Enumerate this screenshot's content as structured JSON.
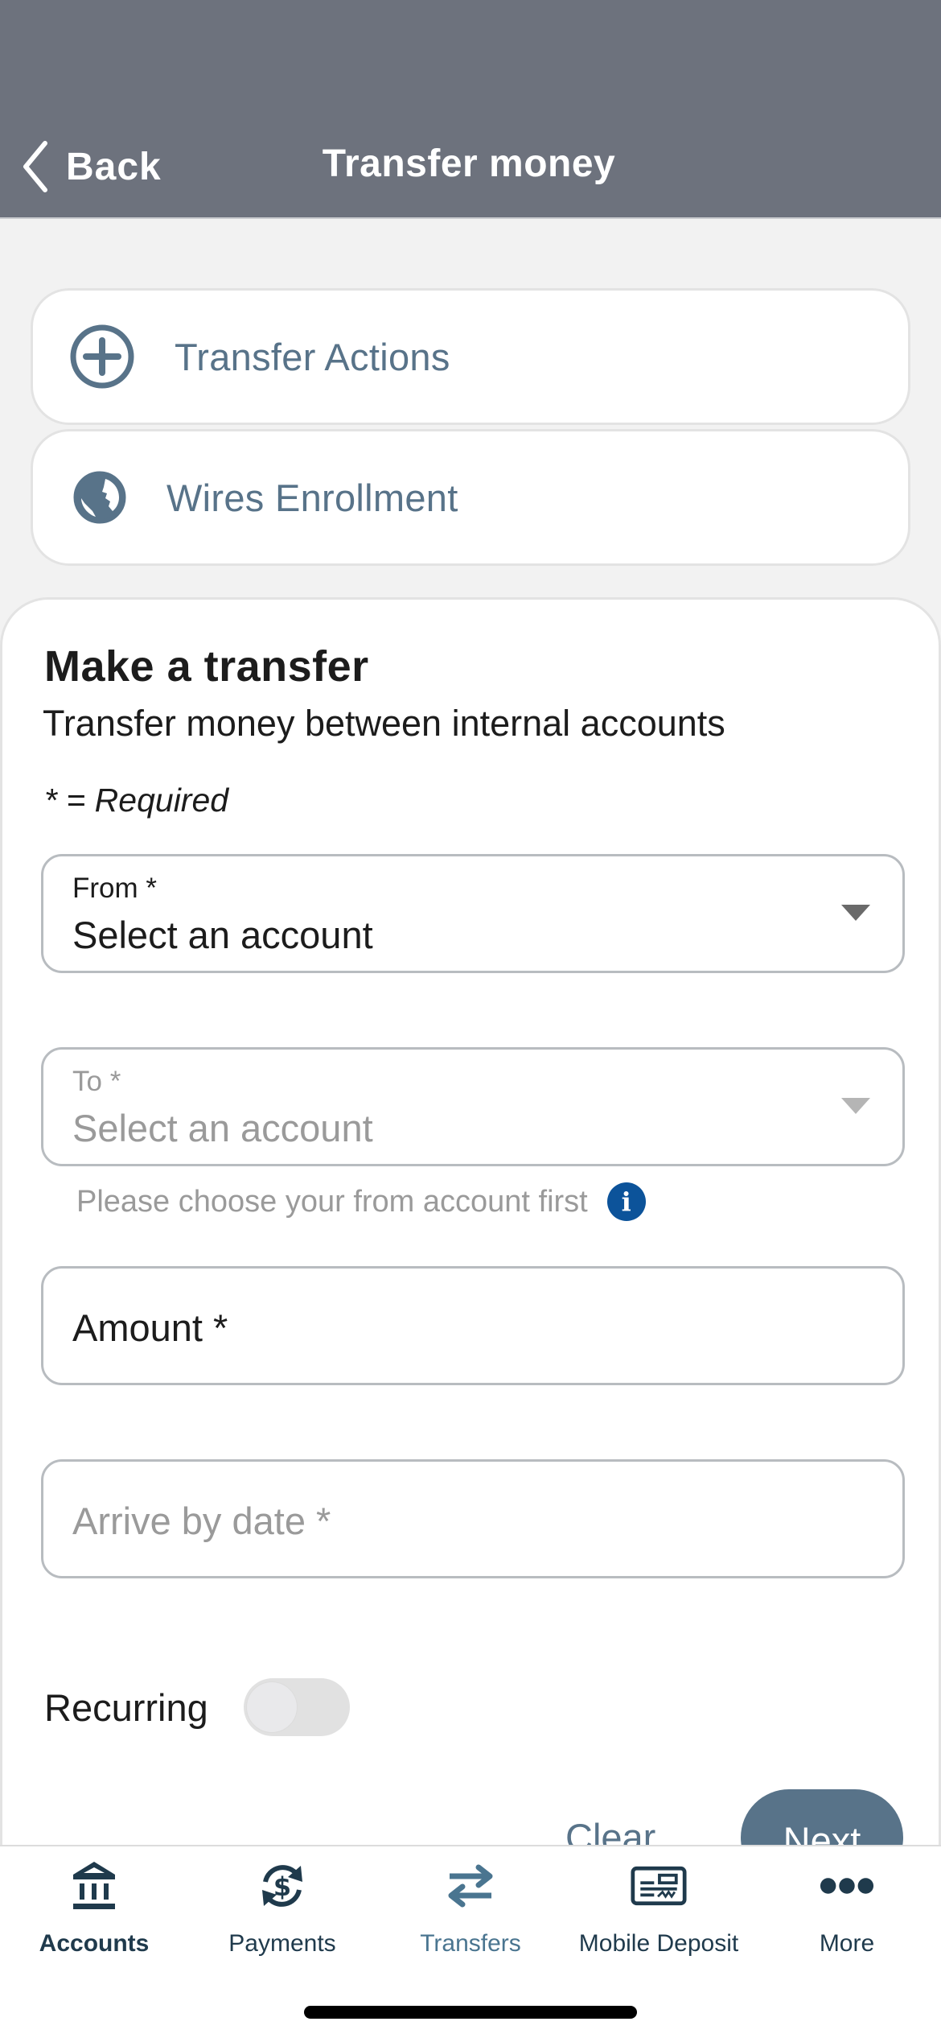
{
  "header": {
    "back_label": "Back",
    "title": "Transfer money",
    "background_color": "#6d727d"
  },
  "action_cards": [
    {
      "label": "Transfer Actions",
      "icon": "plus-circle-icon"
    },
    {
      "label": "Wires Enrollment",
      "icon": "globe-icon"
    }
  ],
  "form": {
    "title": "Make a transfer",
    "subtitle": "Transfer money between internal accounts",
    "required_note": "* = Required",
    "from": {
      "label": "From *",
      "value": "Select an account"
    },
    "to": {
      "label": "To *",
      "value": "Select an account",
      "disabled": true
    },
    "to_helper": "Please choose your from account first",
    "amount": {
      "placeholder": "Amount *"
    },
    "arrive_by_date": {
      "placeholder": "Arrive by date *"
    },
    "recurring": {
      "label": "Recurring",
      "enabled": false
    },
    "clear_label": "Clear",
    "next_label": "Next"
  },
  "tabbar": {
    "items": [
      {
        "label": "Accounts",
        "icon": "bank-icon",
        "active": false
      },
      {
        "label": "Payments",
        "icon": "dollar-cycle-icon",
        "active": false
      },
      {
        "label": "Transfers",
        "icon": "transfer-arrows-icon",
        "active": true
      },
      {
        "label": "Mobile Deposit",
        "icon": "check-deposit-icon",
        "active": false
      },
      {
        "label": "More",
        "icon": "more-dots-icon",
        "active": false
      }
    ]
  },
  "colors": {
    "accent": "#587389",
    "active_tab": "#4a7590",
    "tab_icon": "#1f3a4c",
    "info": "#0c539a"
  }
}
